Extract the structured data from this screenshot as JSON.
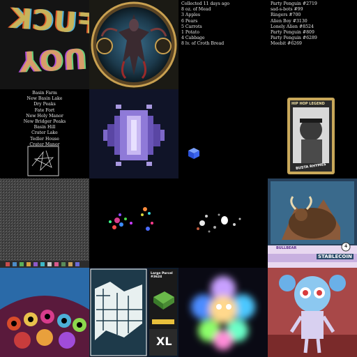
{
  "tiles": {
    "t1": {
      "word_top": "FUCK",
      "word_bottom": "YOU"
    },
    "t3": {
      "header": "Collected 11 days ago",
      "items": [
        "8 oz. of Mead",
        "3 Apples",
        "6 Pears",
        "5 Carrots",
        "1 Potato",
        "4 Cabbage",
        "8 lv. of Croth Bread"
      ]
    },
    "t4": {
      "items": [
        "Party Penguin #2719",
        "sad-s-bots #99",
        "Ringers #700",
        "Alien Boy #3130",
        "Lonely Alien #8524",
        "Party Penguin #809",
        "Party Penguin #6289",
        "Meebit #6269"
      ]
    },
    "t5": {
      "items": [
        "Basin Farm",
        "New Basin Lake",
        "Dry Peaks",
        "Fate Fort",
        "New Holy Manor",
        "New Bridger Peaks",
        "Basin Hill",
        "Crater Lake",
        "Tedler House",
        "Crater Manor"
      ]
    },
    "t8": {
      "card_title": "HIP HOP LEGEND",
      "card_name": "BUSTA RHYMES"
    },
    "t12": {
      "name": "BULLBEAR",
      "sub": "STABLECOIN",
      "num": "4"
    },
    "t14": {
      "parcel_title": "Large Parcel #3624",
      "size": "XL"
    }
  },
  "colors": {
    "background": "#000000",
    "text": "#e8e8e8"
  }
}
